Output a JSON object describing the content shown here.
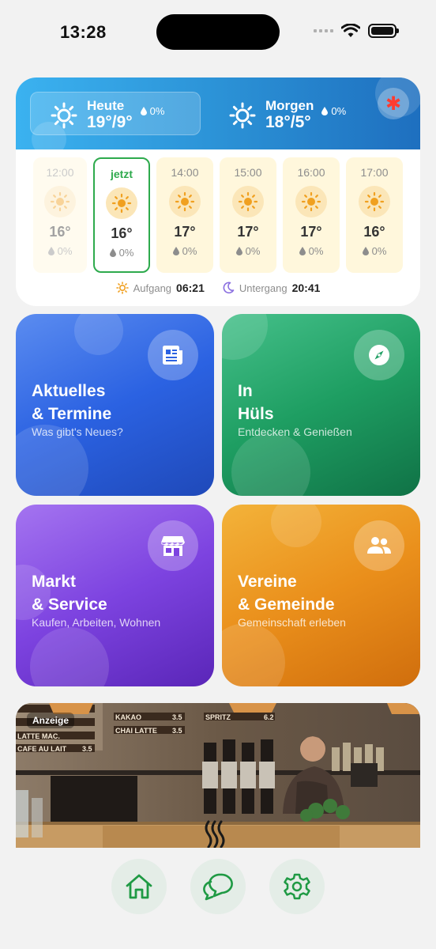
{
  "status_bar": {
    "time": "13:28"
  },
  "weather": {
    "today": {
      "label": "Heute",
      "temps": "19°/9°",
      "rain": "0%"
    },
    "tomorrow": {
      "label": "Morgen",
      "temps": "18°/5°",
      "rain": "0%"
    },
    "alert_icon": "asterisk-alert-icon",
    "hourly": [
      {
        "time": "12:00",
        "temp": "16°",
        "rain": "0%",
        "state": "past"
      },
      {
        "time": "jetzt",
        "temp": "16°",
        "rain": "0%",
        "state": "now"
      },
      {
        "time": "14:00",
        "temp": "17°",
        "rain": "0%",
        "state": "future"
      },
      {
        "time": "15:00",
        "temp": "17°",
        "rain": "0%",
        "state": "future"
      },
      {
        "time": "16:00",
        "temp": "17°",
        "rain": "0%",
        "state": "future"
      },
      {
        "time": "17:00",
        "temp": "16°",
        "rain": "0%",
        "state": "future"
      }
    ],
    "sunrise": {
      "label": "Aufgang",
      "time": "06:21"
    },
    "sunset": {
      "label": "Untergang",
      "time": "20:41"
    }
  },
  "tiles": {
    "news": {
      "line1": "Aktuelles",
      "line2": "& Termine",
      "subtitle": "Was gibt's Neues?",
      "icon": "newspaper-icon"
    },
    "huels": {
      "line1": "In",
      "line2": "Hüls",
      "subtitle": "Entdecken & Genießen",
      "icon": "compass-icon"
    },
    "market": {
      "line1": "Markt",
      "line2": "& Service",
      "subtitle": "Kaufen, Arbeiten, Wohnen",
      "icon": "store-icon"
    },
    "clubs": {
      "line1": "Vereine",
      "line2": "& Gemeinde",
      "subtitle": "Gemeinschaft erleben",
      "icon": "people-icon"
    }
  },
  "ad": {
    "label": "Anzeige",
    "menu": [
      "KAKAO",
      "CHAI LATTE",
      "LATTE MAC.",
      "CAFE AU LAIT",
      "SPRITZ"
    ],
    "prices": [
      "3.5",
      "3.5",
      "3.5",
      "6.2"
    ]
  },
  "nav": {
    "home_icon": "home-icon",
    "chat_icon": "chat-icon",
    "settings_icon": "gear-icon"
  },
  "colors": {
    "accent_green": "#2eaa4d",
    "weather_blue": "#2a8fd4",
    "tile_blue": "#2b62e2",
    "tile_green": "#1e9e62",
    "tile_purple": "#7d43e0",
    "tile_orange": "#ea8f1b"
  }
}
